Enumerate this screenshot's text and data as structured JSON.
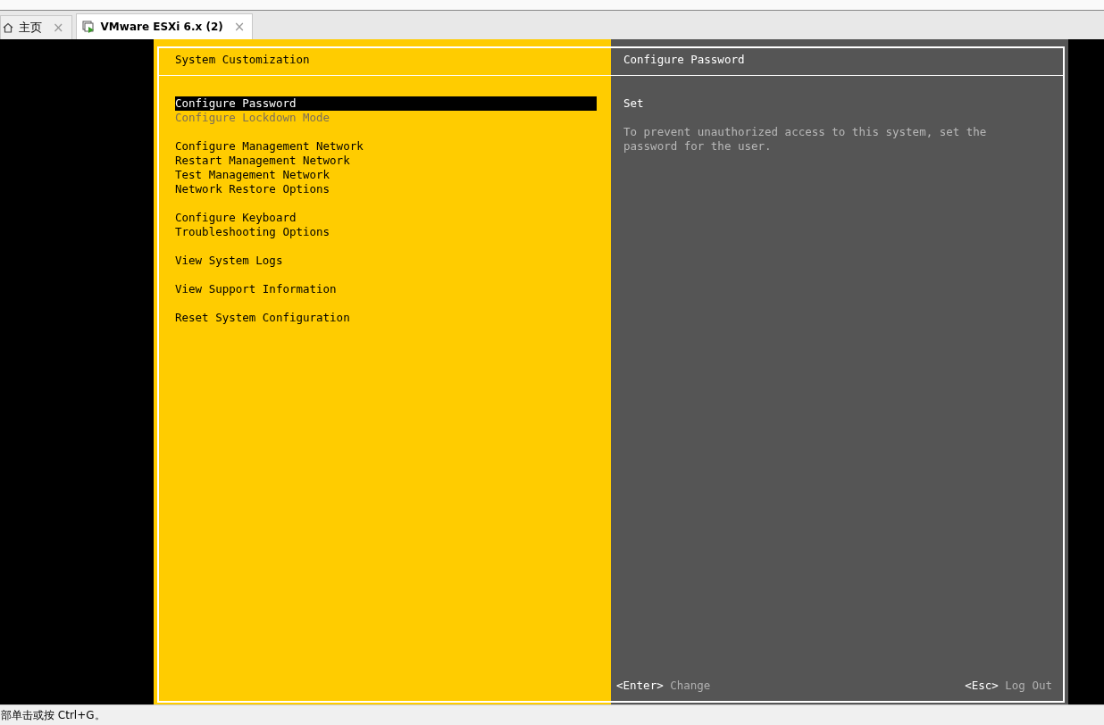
{
  "tabs": [
    {
      "label": "主页",
      "kind": "home",
      "selected": false,
      "close": "×"
    },
    {
      "label": "VMware ESXi 6.x (2)",
      "kind": "vm",
      "selected": true,
      "close": "×"
    }
  ],
  "console": {
    "menu_title": "System Customization",
    "menu_groups": [
      {
        "items": [
          {
            "label": "Configure Password",
            "selected": true,
            "disabled": false
          },
          {
            "label": "Configure Lockdown Mode",
            "selected": false,
            "disabled": true
          }
        ]
      },
      {
        "items": [
          {
            "label": "Configure Management Network",
            "selected": false,
            "disabled": false
          },
          {
            "label": "Restart Management Network",
            "selected": false,
            "disabled": false
          },
          {
            "label": "Test Management Network",
            "selected": false,
            "disabled": false
          },
          {
            "label": "Network Restore Options",
            "selected": false,
            "disabled": false
          }
        ]
      },
      {
        "items": [
          {
            "label": "Configure Keyboard",
            "selected": false,
            "disabled": false
          },
          {
            "label": "Troubleshooting Options",
            "selected": false,
            "disabled": false
          }
        ]
      },
      {
        "items": [
          {
            "label": "View System Logs",
            "selected": false,
            "disabled": false
          }
        ]
      },
      {
        "items": [
          {
            "label": "View Support Information",
            "selected": false,
            "disabled": false
          }
        ]
      },
      {
        "items": [
          {
            "label": "Reset System Configuration",
            "selected": false,
            "disabled": false
          }
        ]
      }
    ],
    "detail_title": "Configure Password",
    "detail_status": "Set",
    "detail_description": "To prevent unauthorized access to this system, set the password for the user.",
    "footer_actions": [
      {
        "key": "<Enter>",
        "action": "Change"
      },
      {
        "key": "<Esc>",
        "action": "Log Out"
      }
    ]
  },
  "status_bar": {
    "text": "部单击或按 Ctrl+G。"
  }
}
